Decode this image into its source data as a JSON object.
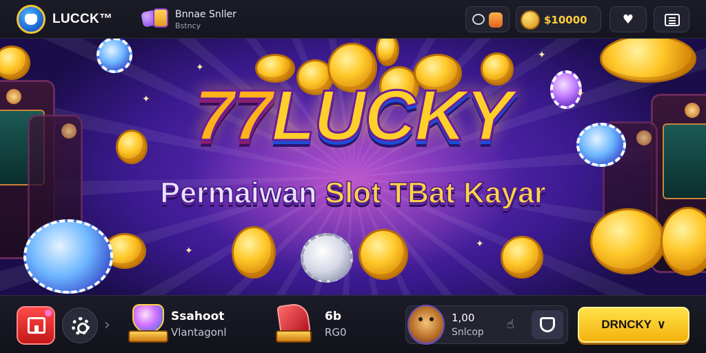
{
  "header": {
    "brand_name": "LUCCK™",
    "promo_title": "Bnnae Snller",
    "promo_subtitle": "Bstncy",
    "balance": "$10000",
    "icons": {
      "logo": "mascot-logo-icon",
      "promo": "gift-icon",
      "chat": "chat-icon",
      "bag": "bag-icon",
      "coin": "coin-icon",
      "heart": "heart-icon",
      "menu": "menu-icon"
    }
  },
  "banner": {
    "title_number": "77",
    "title_word": "LUCKY",
    "subtitle_part1": "Permaiwan",
    "subtitle_part2": "Slot TBat Kayar"
  },
  "footer": {
    "game1_title": "Ssahoot",
    "game1_subtitle": "Vlantagonl",
    "game2_title": "6b",
    "game2_subtitle": "RG0",
    "player_amount": "1,00",
    "player_subtitle": "Snlcop",
    "chevron": "›",
    "hand_glyph": "☝",
    "cta_label": "DRNCKY",
    "cta_chevron": "∨",
    "icons": {
      "home": "home-icon",
      "settings": "gear-icon",
      "game1": "gem-icon",
      "game2": "red-gem-icon",
      "player": "avatar-icon",
      "action": "shield-icon"
    }
  },
  "colors": {
    "accent_gold": "#ffcf2a",
    "cta": "#f3b20c",
    "home_red": "#c41818",
    "banner_purple": "#6f2fd1"
  }
}
